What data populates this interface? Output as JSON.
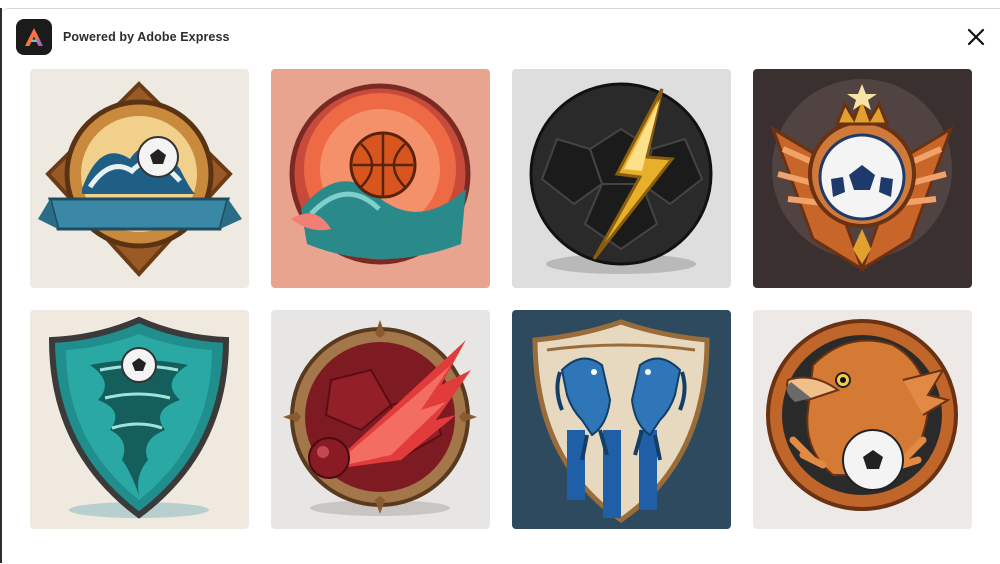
{
  "header": {
    "brand_text": "Powered by Adobe Express",
    "logo_icon": "adobe-express-logo-icon",
    "close_icon": "close-icon"
  },
  "gallery": {
    "items": [
      {
        "name": "wave-soccer-badge",
        "subject": "ocean wave with soccer ball and ribbon banner",
        "bg": "#eeeae2"
      },
      {
        "name": "splash-basketball-badge",
        "subject": "orange ball over teal wave in red circle",
        "bg": "#e9a490"
      },
      {
        "name": "lightning-ball-badge",
        "subject": "black soccer ball with golden lightning bolt",
        "bg": "#dedede"
      },
      {
        "name": "winged-crown-soccer-badge",
        "subject": "soccer ball with crown and orange wings",
        "bg": "#3a3030"
      },
      {
        "name": "tornado-shield-badge",
        "subject": "teal tornado with soccer ball on shield",
        "bg": "#efe9df"
      },
      {
        "name": "fireball-badge",
        "subject": "crimson ball with flaming meteor",
        "bg": "#e8e6e4"
      },
      {
        "name": "horses-shield-badge",
        "subject": "two blue horses on striped shield",
        "bg": "#2e4a5e"
      },
      {
        "name": "eagle-soccer-badge",
        "subject": "orange eagle holding soccer ball",
        "bg": "#ece9e7"
      }
    ]
  },
  "colors": {
    "accent": "#000000",
    "brand_dark": "#1b1b1b",
    "orange": "#e2702f",
    "teal": "#2a9a9a",
    "gold": "#d8a12e"
  }
}
